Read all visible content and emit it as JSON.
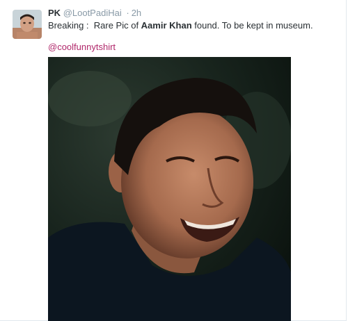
{
  "tweet": {
    "display_name": "PK",
    "handle": "@LootPadiHai",
    "separator": "·",
    "time": "2h",
    "text_before": "Breaking :  Rare Pic of ",
    "text_bold": "Aamir Khan",
    "text_after": " found. To be kept in museum.",
    "mention": "@coolfunnytshirt"
  },
  "colors": {
    "mention": "#b0276a",
    "muted": "#8899a6",
    "text": "#292f33"
  },
  "icons": {
    "avatar": "profile-photo",
    "photo": "laughing-man-photo"
  }
}
